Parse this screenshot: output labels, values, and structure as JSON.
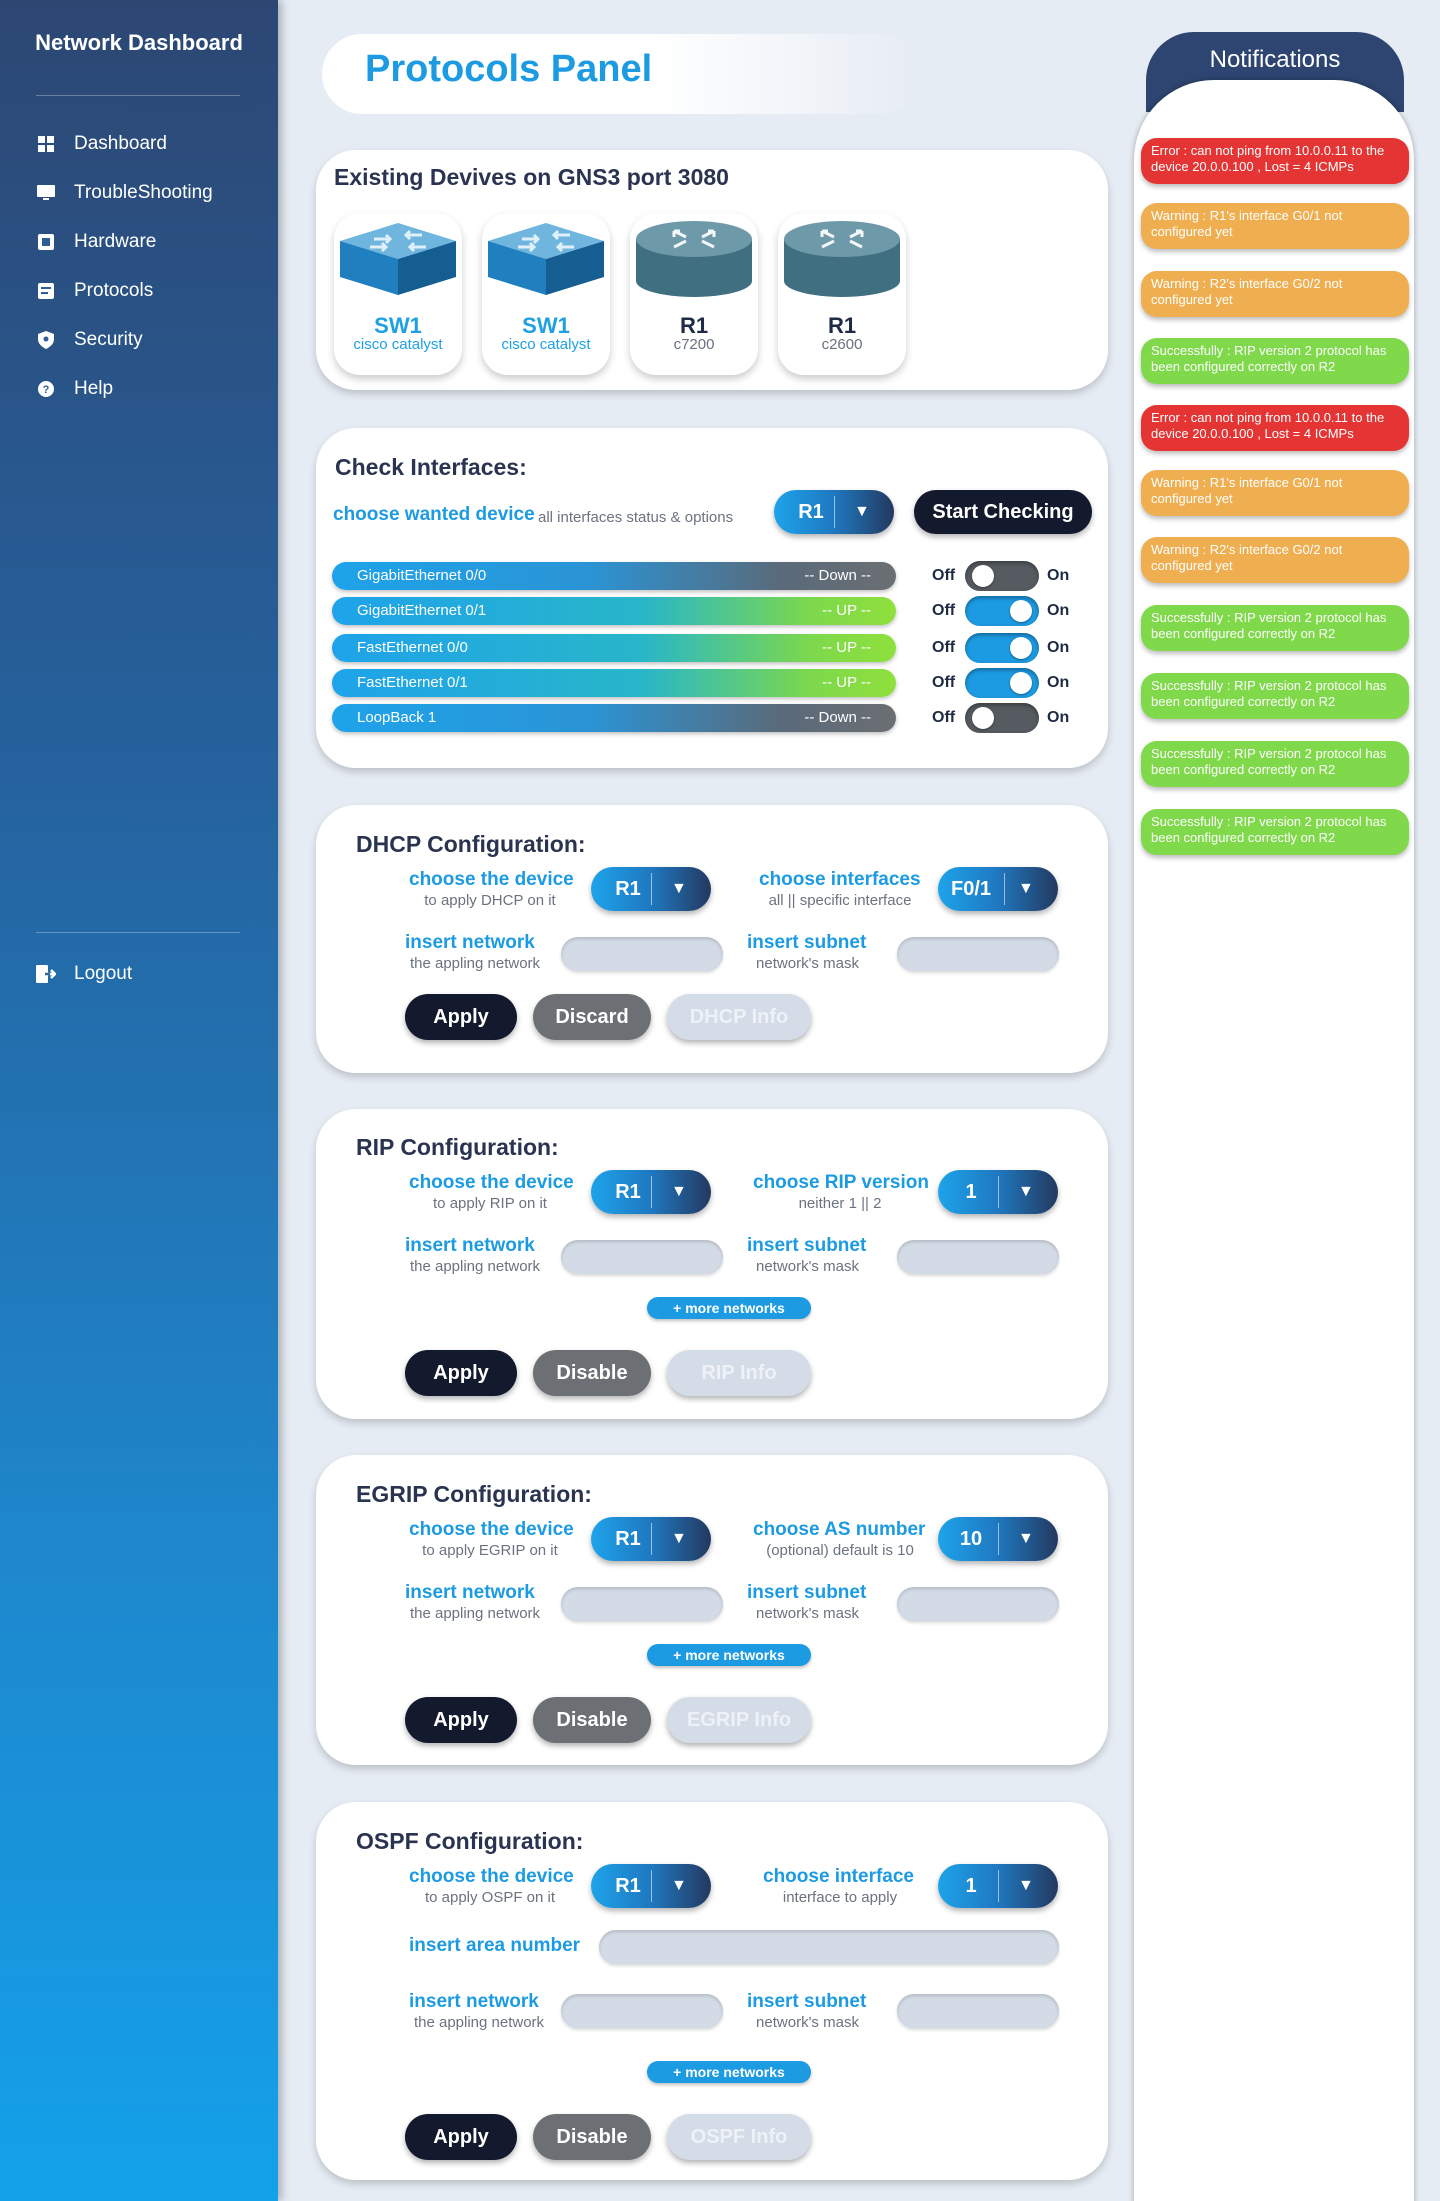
{
  "sidebar": {
    "title": "Network Dashboard",
    "items": [
      {
        "label": "Dashboard",
        "icon": "dashboard-icon"
      },
      {
        "label": "TroubleShooting",
        "icon": "monitor-icon"
      },
      {
        "label": "Hardware",
        "icon": "hardware-icon"
      },
      {
        "label": "Protocols",
        "icon": "protocols-icon"
      },
      {
        "label": "Security",
        "icon": "shield-icon"
      },
      {
        "label": "Help",
        "icon": "help-icon"
      }
    ],
    "logout": "Logout"
  },
  "header": {
    "title": "Protocols Panel"
  },
  "devices": {
    "title": "Existing Devives on GNS3 port 3080",
    "items": [
      {
        "name": "SW1",
        "model": "cisco catalyst",
        "type": "switch"
      },
      {
        "name": "SW1",
        "model": "cisco catalyst",
        "type": "switch"
      },
      {
        "name": "R1",
        "model": "c7200",
        "type": "router"
      },
      {
        "name": "R1",
        "model": "c2600",
        "type": "router"
      }
    ]
  },
  "interfaces": {
    "title": "Check Interfaces:",
    "choose_label": "choose wanted device",
    "choose_sub": "all interfaces status & options",
    "device": "R1",
    "start_button": "Start Checking",
    "off_label": "Off",
    "on_label": "On",
    "rows": [
      {
        "name": "GigabitEthernet 0/0",
        "status": "-- Down --",
        "on": false
      },
      {
        "name": "GigabitEthernet 0/1",
        "status": "-- UP --",
        "on": true
      },
      {
        "name": "FastEthernet 0/0",
        "status": "-- UP --",
        "on": true
      },
      {
        "name": "FastEthernet 0/1",
        "status": "-- UP --",
        "on": true
      },
      {
        "name": "LoopBack 1",
        "status": "-- Down --",
        "on": false
      }
    ]
  },
  "dhcp": {
    "title": "DHCP Configuration:",
    "device_label": "choose the device",
    "device_sub": "to apply DHCP on it",
    "device_value": "R1",
    "iface_label": "choose interfaces",
    "iface_sub": "all || specific interface",
    "iface_value": "F0/1",
    "network_label": "insert network",
    "network_sub": "the appling network",
    "subnet_label": "insert subnet",
    "subnet_sub": "network's mask",
    "apply": "Apply",
    "discard": "Discard",
    "info": "DHCP Info"
  },
  "rip": {
    "title": "RIP Configuration:",
    "device_label": "choose the device",
    "device_sub": "to apply RIP on it",
    "device_value": "R1",
    "version_label": "choose RIP version",
    "version_sub": "neither 1 || 2",
    "version_value": "1",
    "network_label": "insert network",
    "network_sub": "the appling network",
    "subnet_label": "insert subnet",
    "subnet_sub": "network's mask",
    "more": "+ more networks",
    "apply": "Apply",
    "disable": "Disable",
    "info": "RIP Info"
  },
  "egrip": {
    "title": "EGRIP Configuration:",
    "device_label": "choose the device",
    "device_sub": "to apply EGRIP on it",
    "device_value": "R1",
    "as_label": "choose AS number",
    "as_sub": "(optional) default is 10",
    "as_value": "10",
    "network_label": "insert network",
    "network_sub": "the appling network",
    "subnet_label": "insert subnet",
    "subnet_sub": "network's mask",
    "more": "+ more networks",
    "apply": "Apply",
    "disable": "Disable",
    "info": "EGRIP Info"
  },
  "ospf": {
    "title": "OSPF Configuration:",
    "device_label": "choose the device",
    "device_sub": "to apply OSPF on it",
    "device_value": "R1",
    "iface_label": "choose interface",
    "iface_sub": "interface to apply",
    "iface_value": "1",
    "area_label": "insert area number",
    "network_label": "insert network",
    "network_sub": "the appling network",
    "subnet_label": "insert subnet",
    "subnet_sub": "network's mask",
    "more": "+ more networks",
    "apply": "Apply",
    "disable": "Disable",
    "info": "OSPF Info"
  },
  "notifications": {
    "title": "Notifications",
    "items": [
      {
        "type": "error",
        "text": "Error : can not ping from 10.0.0.11 to the device 20.0.0.100 , Lost = 4 ICMPs"
      },
      {
        "type": "warning",
        "text": "Warning : R1's interface G0/1 not configured yet"
      },
      {
        "type": "warning",
        "text": "Warning : R2's interface G0/2 not configured yet"
      },
      {
        "type": "success",
        "text": "Successfully : RIP version 2 protocol has been configured correctly on R2"
      },
      {
        "type": "error",
        "text": "Error : can not ping from 10.0.0.11 to the device 20.0.0.100 , Lost = 4 ICMPs"
      },
      {
        "type": "warning",
        "text": "Warning : R1's interface G0/1 not configured yet"
      },
      {
        "type": "warning",
        "text": "Warning : R2's interface G0/2 not configured yet"
      },
      {
        "type": "success",
        "text": "Successfully : RIP version 2 protocol has been configured correctly on R2"
      },
      {
        "type": "success",
        "text": "Successfully : RIP version 2 protocol has been configured correctly on R2"
      },
      {
        "type": "success",
        "text": "Successfully : RIP version 2 protocol has been configured correctly on R2"
      },
      {
        "type": "success",
        "text": "Successfully : RIP version 2 protocol has been configured correctly on R2"
      }
    ]
  },
  "colors": {
    "accent": "#1d9be2",
    "dark": "#141a2e",
    "error": "#e53434",
    "warning": "#efae50",
    "success": "#7fd94a"
  }
}
